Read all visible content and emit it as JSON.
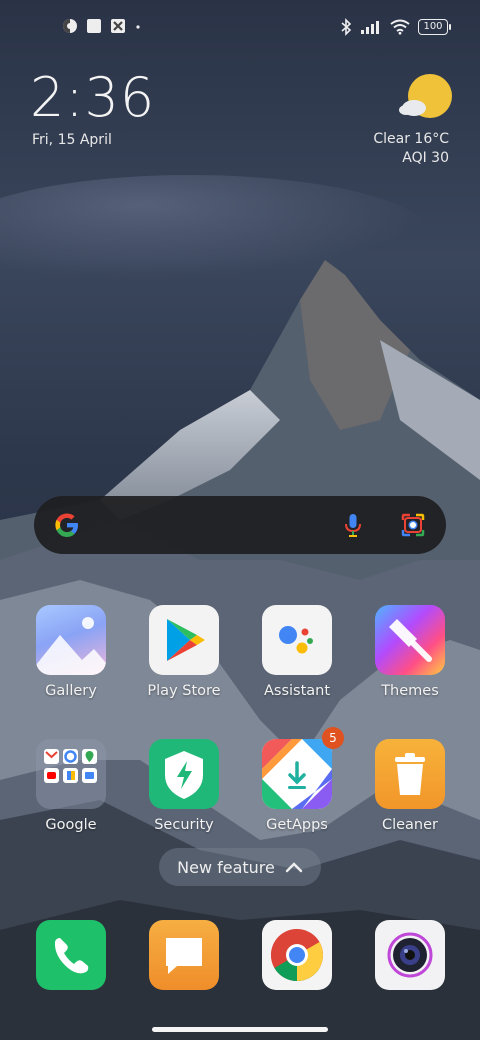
{
  "status": {
    "battery": "100",
    "left_icons": [
      "data-saver-icon",
      "square-notification-icon",
      "app-notification-icon",
      "dot-icon"
    ],
    "right_icons": [
      "bluetooth-icon",
      "signal-icon",
      "wifi-icon",
      "battery-icon"
    ]
  },
  "clock": {
    "time": "2:36",
    "date": "Fri, 15 April"
  },
  "weather": {
    "condition_temp": "Clear  16°C",
    "aqi": "AQI 30",
    "icon": "sun-cloud-icon"
  },
  "search": {
    "icons": [
      "google-g-icon",
      "mic-icon",
      "lens-icon"
    ]
  },
  "apps_row1": [
    {
      "label": "Gallery"
    },
    {
      "label": "Play Store"
    },
    {
      "label": "Assistant"
    },
    {
      "label": "Themes"
    }
  ],
  "apps_row2": [
    {
      "label": "Google"
    },
    {
      "label": "Security"
    },
    {
      "label": "GetApps",
      "badge": "5"
    },
    {
      "label": "Cleaner"
    }
  ],
  "new_feature": {
    "label": "New feature"
  },
  "dock": [
    "Phone",
    "Messages",
    "Chrome",
    "Camera"
  ],
  "colors": {
    "accent": "#e0521f"
  }
}
